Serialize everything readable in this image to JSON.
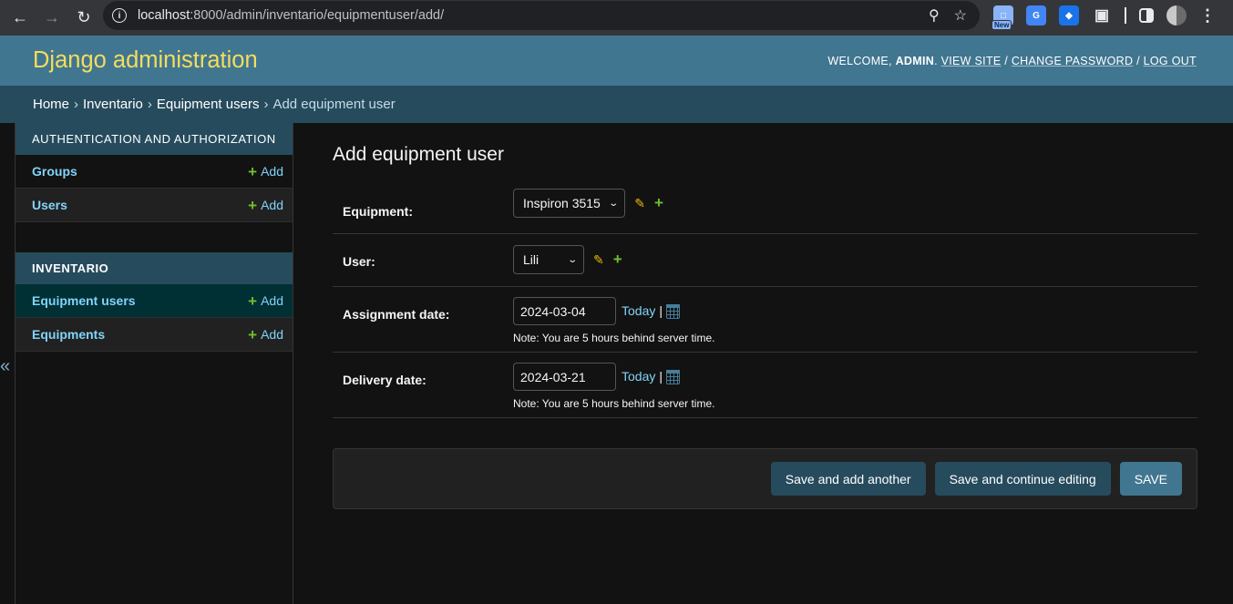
{
  "browser": {
    "url_host": "localhost",
    "url_rest": ":8000/admin/inventario/equipmentuser/add/",
    "ext_new_badge": "New"
  },
  "header": {
    "branding": "Django administration",
    "welcome": "WELCOME,",
    "username": "ADMIN",
    "view_site": "VIEW SITE",
    "change_password": "CHANGE PASSWORD",
    "log_out": "LOG OUT"
  },
  "breadcrumbs": [
    "Home",
    "Inventario",
    "Equipment users",
    "Add equipment user"
  ],
  "sidebar": {
    "toggle": "«",
    "modules": [
      {
        "caption": "Authentication and Authorization",
        "models": [
          {
            "name": "Groups",
            "add": "Add"
          },
          {
            "name": "Users",
            "add": "Add"
          }
        ]
      },
      {
        "caption": "Inventario",
        "models": [
          {
            "name": "Equipment users",
            "add": "Add"
          },
          {
            "name": "Equipments",
            "add": "Add"
          }
        ]
      }
    ]
  },
  "form": {
    "title": "Add equipment user",
    "equipment_label": "Equipment:",
    "equipment_value": "Inspiron 3515",
    "user_label": "User:",
    "user_value": "Lili",
    "assignment_label": "Assignment date:",
    "assignment_value": "2024-03-04",
    "delivery_label": "Delivery date:",
    "delivery_value": "2024-03-21",
    "today": "Today",
    "separator": "|",
    "timezone_note": "Note: You are 5 hours behind server time."
  },
  "buttons": {
    "save_add_another": "Save and add another",
    "save_continue": "Save and continue editing",
    "save": "SAVE"
  },
  "colors": {
    "header_bg": "#417690",
    "branding": "#f5dd5d",
    "breadcrumbs_bg": "#264b5d",
    "link": "#81d4fa",
    "add_icon": "#70bf2b",
    "change_icon": "#efb80b"
  },
  "icons": {
    "back": "arrow-left-icon",
    "forward": "arrow-right-icon",
    "reload": "reload-icon",
    "site_info": "info-icon",
    "zoom": "zoom-icon",
    "bookmark": "star-icon",
    "extensions": "puzzle-icon",
    "menu": "kebab-menu-icon",
    "calendar": "calendar-icon",
    "change": "pencil-icon",
    "add": "plus-icon"
  }
}
